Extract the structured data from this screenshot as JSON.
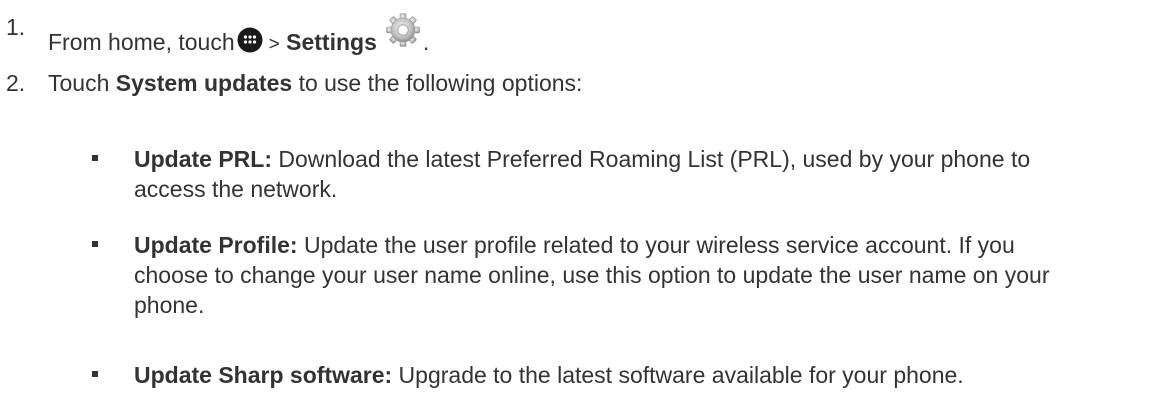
{
  "steps": [
    {
      "number": "1.",
      "prefix": "From home, touch",
      "separator": ">",
      "bold": "Settings",
      "suffix": ".",
      "icons": [
        "apps-icon",
        "settings-gear-icon"
      ]
    },
    {
      "number": "2.",
      "prefix": "Touch",
      "bold": "System updates",
      "suffix": "to use the following options:"
    }
  ],
  "options": [
    {
      "term": "Update PRL:",
      "desc_line1": "Download the latest Preferred Roaming List (PRL), used by your phone to",
      "desc_line2": "access the network."
    },
    {
      "term": "Update Profile:",
      "desc_line1": "Update the user profile related to your wireless service account. If you",
      "desc_line2": "choose to change your user name online, use this option to update the user name on your",
      "desc_line3": "phone."
    },
    {
      "term": "Update Sharp software:",
      "desc_line1": "Upgrade to the latest software available for your phone."
    }
  ]
}
